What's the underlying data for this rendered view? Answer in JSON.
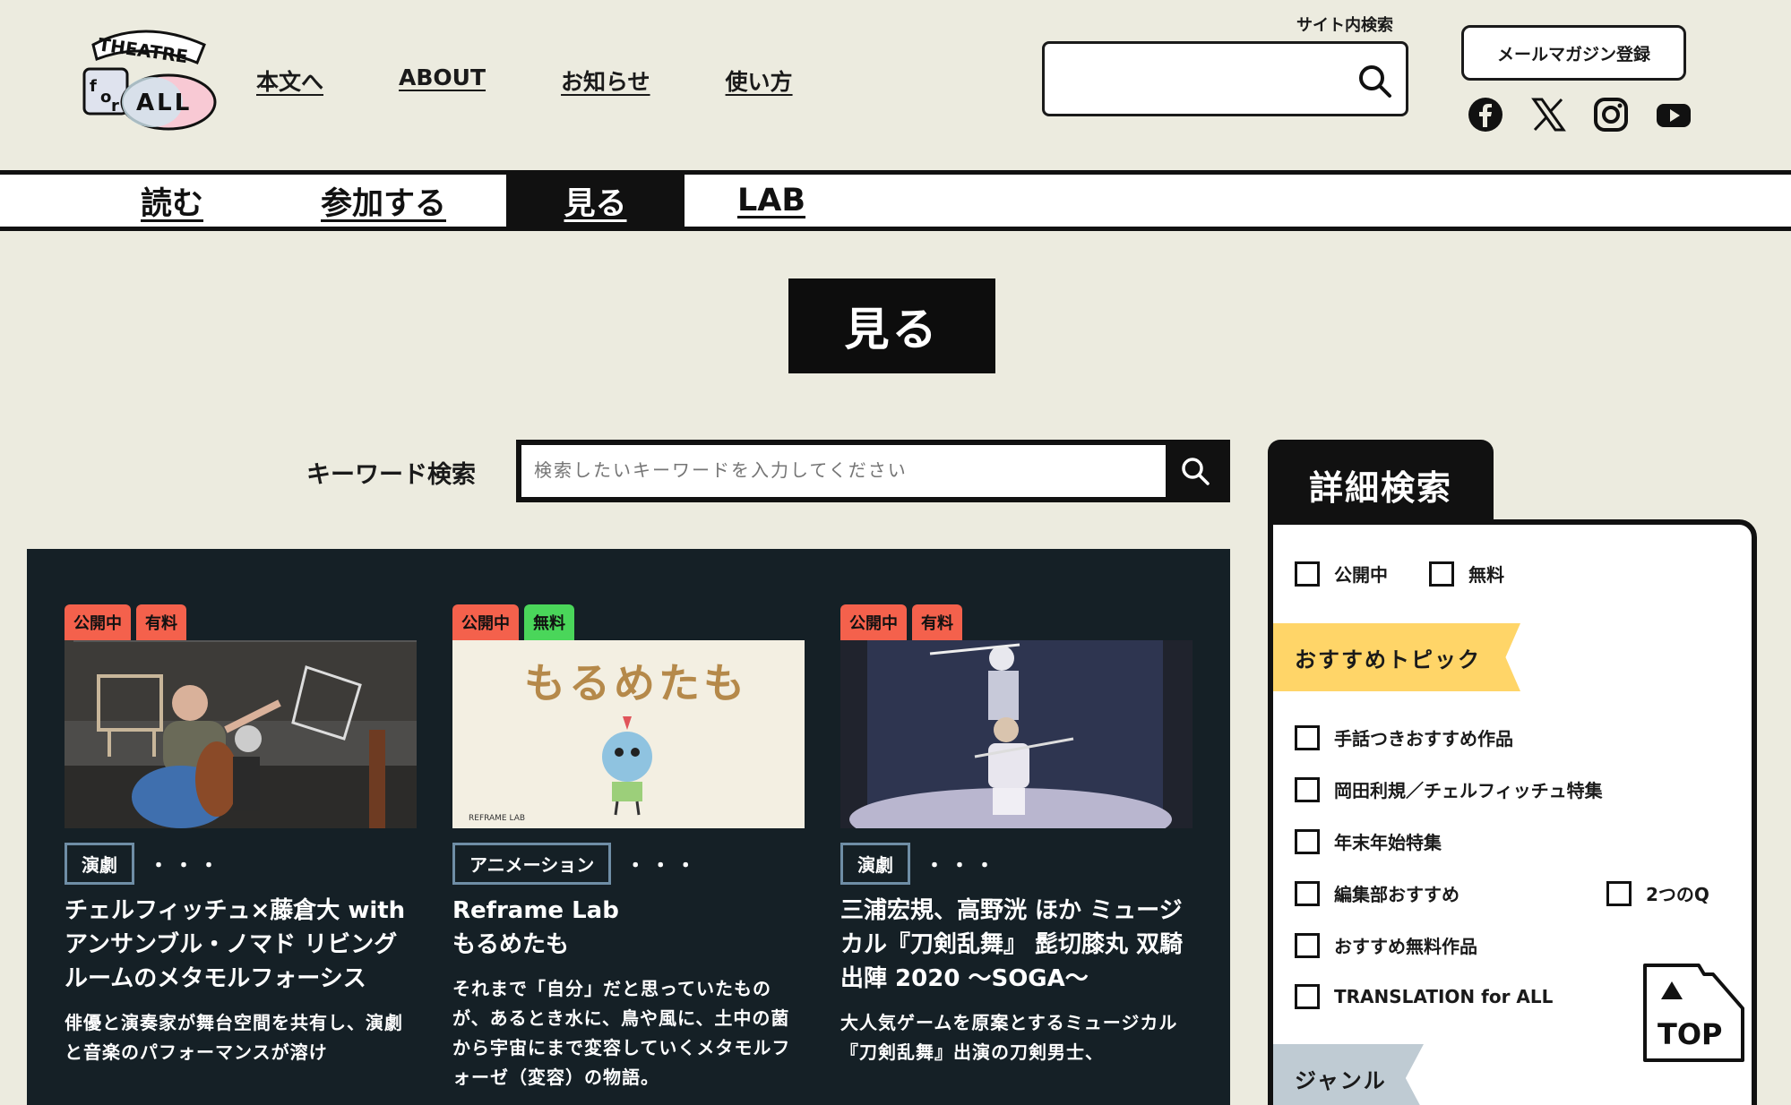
{
  "header": {
    "logo": {
      "line1": "THEATRE",
      "line2a": "f",
      "line2b": "o",
      "line2c": "r",
      "line3": "ALL"
    },
    "nav": [
      "本文へ",
      "ABOUT",
      "お知らせ",
      "使い方"
    ],
    "site_search_label": "サイト内検索",
    "site_search_placeholder": "",
    "mail_button": "メールマガジン登録",
    "social": [
      "facebook-icon",
      "x-icon",
      "instagram-icon",
      "youtube-icon"
    ]
  },
  "tabs": [
    "読む",
    "参加する",
    "見る",
    "LAB"
  ],
  "active_tab": "見る",
  "page_title": "見る",
  "keyword_search": {
    "label": "キーワード検索",
    "placeholder": "検索したいキーワードを入力してください"
  },
  "cards": [
    {
      "badges": [
        {
          "text": "公開中",
          "color": "#f4614c"
        },
        {
          "text": "有料",
          "color": "#f4614c"
        }
      ],
      "genre": "演劇",
      "more": "・・・",
      "title": "チェルフィッチュ×藤倉大 with アンサンブル・ノマド リビングルームのメタモルフォーシス",
      "desc": "俳優と演奏家が舞台空間を共有し、演劇と音楽のパフォーマンスが溶け"
    },
    {
      "badges": [
        {
          "text": "公開中",
          "color": "#f4614c"
        },
        {
          "text": "無料",
          "color": "#4ad65a"
        }
      ],
      "genre": "アニメーション",
      "more": "・・・",
      "thumb_text": "もるめたも",
      "thumb_credit": "REFRAME LAB",
      "title_line1": "Reframe Lab",
      "title_line2": "もるめたも",
      "desc": "それまで「自分」だと思っていたものが、あるとき水に、鳥や風に、土中の菌から宇宙にまで変容していくメタモルフォーゼ（変容）の物語。"
    },
    {
      "badges": [
        {
          "text": "公開中",
          "color": "#f4614c"
        },
        {
          "text": "有料",
          "color": "#f4614c"
        }
      ],
      "genre": "演劇",
      "more": "・・・",
      "title": "三浦宏規、高野洸 ほか ミュージカル『刀剣乱舞』 髭切膝丸 双騎出陣 2020 ～SOGA～",
      "desc": "大人気ゲームを原案とするミュージカル『刀剣乱舞』出演の刀剣男士、"
    }
  ],
  "detail_search": {
    "title": "詳細検索",
    "status_filters": [
      "公開中",
      "無料"
    ],
    "recommended_label": "おすすめトピック",
    "topics": [
      "手話つきおすすめ作品",
      "岡田利規／チェルフィッチュ特集",
      "年末年始特集",
      "編集部おすすめ",
      "2つのQ",
      "おすすめ無料作品",
      "TRANSLATION for ALL"
    ],
    "genre_label": "ジャンル"
  },
  "top_button": "TOP"
}
